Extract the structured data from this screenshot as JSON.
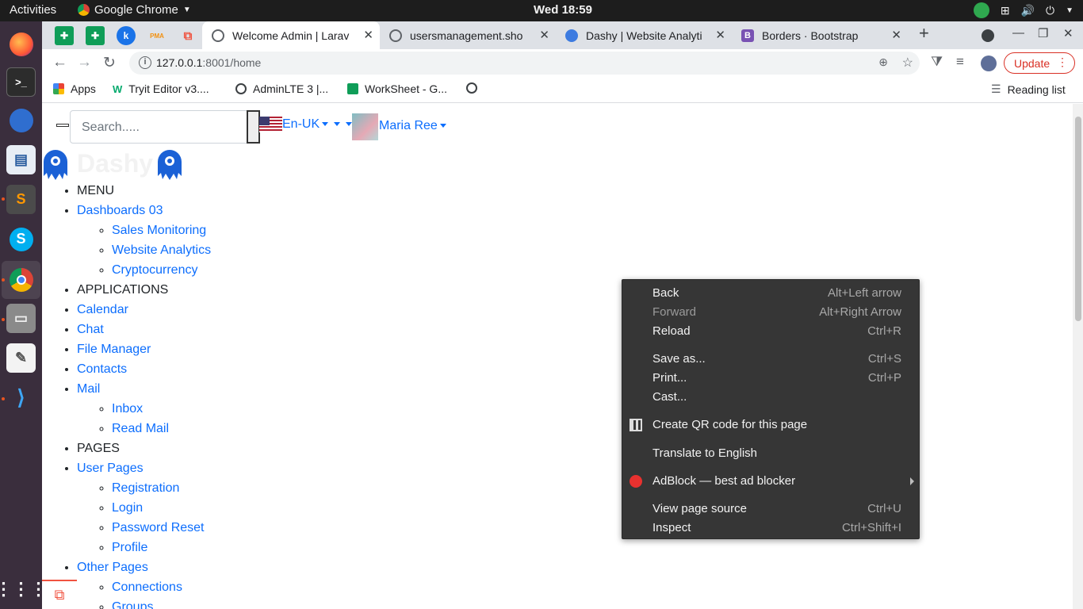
{
  "system": {
    "activities": "Activities",
    "app_name": "Google Chrome",
    "clock": "Wed 18:59"
  },
  "dock": {
    "apps": [
      "firefox-icon",
      "terminal-icon",
      "thunderbird-icon",
      "document-viewer-icon",
      "sublime-text-icon",
      "skype-icon",
      "chrome-icon",
      "files-icon",
      "text-editor-icon",
      "vscode-icon",
      "app-grid-icon"
    ]
  },
  "tabs": {
    "pinned": [
      {
        "icon": "google-sheets-icon",
        "color": "#0f9d58"
      },
      {
        "icon": "google-sheets-icon",
        "color": "#0f9d58"
      },
      {
        "icon": "k-icon",
        "color": "#1a73e8",
        "letter": "k"
      },
      {
        "icon": "phpmyadmin-icon",
        "color": "#f29111",
        "letter": "PMA"
      },
      {
        "icon": "laravel-icon",
        "color": "#f05340"
      }
    ],
    "items": [
      {
        "title": "Welcome Admin | Larav",
        "active": true
      },
      {
        "title": "usersmanagement.sho",
        "active": false
      },
      {
        "title": "Dashy | Website Analyti",
        "active": false
      },
      {
        "title": "Borders · Bootstrap",
        "active": false
      }
    ],
    "new_tab": "+"
  },
  "toolbar": {
    "url_host": "127.0.0.1",
    "url_rest": ":8001/home",
    "update_label": "Update"
  },
  "bookmarks": {
    "items": [
      {
        "label": "Apps"
      },
      {
        "label": "Tryit Editor v3...."
      },
      {
        "label": "AdminLTE 3 |..."
      },
      {
        "label": "WorkSheet - G..."
      },
      {
        "label": ""
      }
    ],
    "reading_list": "Reading list"
  },
  "page": {
    "search_placeholder": "Search.....",
    "language": "En-UK",
    "user_name": "Maria Ree",
    "brand": "Dashy",
    "menu": {
      "menu_heading": "MENU",
      "dashboards": "Dashboards 03",
      "sales_monitoring": "Sales Monitoring",
      "website_analytics": "Website Analytics",
      "cryptocurrency": "Cryptocurrency",
      "applications_heading": "APPLICATIONS",
      "calendar": "Calendar",
      "chat": "Chat",
      "file_manager": "File Manager",
      "contacts": "Contacts",
      "mail": "Mail",
      "inbox": "Inbox",
      "read_mail": "Read Mail",
      "pages_heading": "PAGES",
      "user_pages": "User Pages",
      "registration": "Registration",
      "login": "Login",
      "password_reset": "Password Reset",
      "profile": "Profile",
      "other_pages": "Other Pages",
      "connections": "Connections",
      "groups": "Groups"
    }
  },
  "context_menu": {
    "back": {
      "label": "Back",
      "key": "Alt+Left arrow"
    },
    "forward": {
      "label": "Forward",
      "key": "Alt+Right Arrow"
    },
    "reload": {
      "label": "Reload",
      "key": "Ctrl+R"
    },
    "save_as": {
      "label": "Save as...",
      "key": "Ctrl+S"
    },
    "print": {
      "label": "Print...",
      "key": "Ctrl+P"
    },
    "cast": {
      "label": "Cast..."
    },
    "qr": {
      "label": "Create QR code for this page"
    },
    "translate": {
      "label": "Translate to English"
    },
    "adblock": {
      "label": "AdBlock — best ad blocker"
    },
    "view_source": {
      "label": "View page source",
      "key": "Ctrl+U"
    },
    "inspect": {
      "label": "Inspect",
      "key": "Ctrl+Shift+I"
    }
  }
}
